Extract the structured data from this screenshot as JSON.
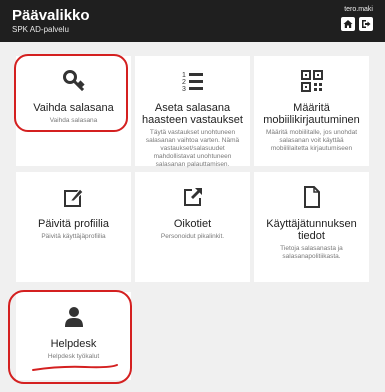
{
  "header": {
    "title": "Päävalikko",
    "subtitle": "SPK AD-palvelu",
    "user": "tero.maki",
    "home_icon": "home-icon",
    "logout_icon": "logout-icon"
  },
  "tiles": [
    {
      "icon": "key-icon",
      "title": "Vaihda salasana",
      "desc": "Vaihda salasana"
    },
    {
      "icon": "numbered-list-icon",
      "title": "Aseta salasana haasteen vastaukset",
      "desc": "Täytä vastaukset unohtuneen salasanan vaihtoa varten. Nämä vastaukset/salasuudet mahdollistavat unohtuneen salasanan palauttamisen."
    },
    {
      "icon": "qr-code-icon",
      "title": "Määritä mobiilikirjautuminen",
      "desc": "Määritä mobiilitalle, jos unohdat salasanan voit käyttää mobiililaitetta kirjautumiseen"
    },
    {
      "icon": "edit-profile-icon",
      "title": "Päivitä profiilia",
      "desc": "Päivitä käyttäjäprofiilia"
    },
    {
      "icon": "external-link-icon",
      "title": "Oikotiet",
      "desc": "Personoidut pikalinkit."
    },
    {
      "icon": "document-icon",
      "title": "Käyttäjätunnuksen tiedot",
      "desc": "Tietoja salasanasta ja salasanapolitiikasta."
    },
    {
      "icon": "user-icon",
      "title": "Helpdesk",
      "desc": "Helpdesk työkalut"
    }
  ],
  "colors": {
    "accent_red": "#d42020",
    "header_bg": "#1f1f1f"
  }
}
